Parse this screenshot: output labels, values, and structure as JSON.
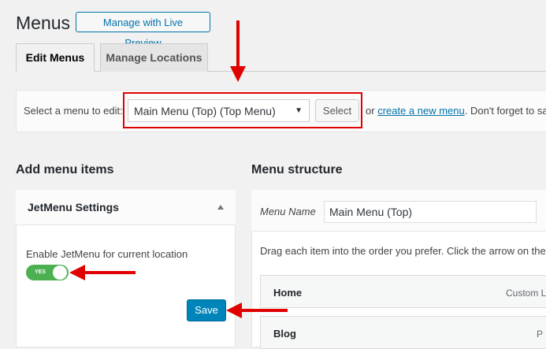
{
  "header": {
    "title": "Menus",
    "live_preview_button": "Manage with Live Preview"
  },
  "tabs": [
    {
      "label": "Edit Menus",
      "active": true
    },
    {
      "label": "Manage Locations",
      "active": false
    }
  ],
  "select_bar": {
    "label": "Select a menu to edit:",
    "selected_menu": "Main Menu (Top) (Top Menu)",
    "select_button": "Select",
    "or_text": "or",
    "create_link": "create a new menu",
    "after_text": ". Don't forget to sa"
  },
  "left": {
    "heading": "Add menu items",
    "panel_title": "JetMenu Settings",
    "enable_label": "Enable JetMenu for current location",
    "toggle_text": "YES",
    "toggle_on": true,
    "save_button": "Save"
  },
  "right": {
    "heading": "Menu structure",
    "menu_name_label": "Menu Name",
    "menu_name_value": "Main Menu (Top)",
    "instructions": "Drag each item into the order you prefer. Click the arrow on the",
    "items": [
      {
        "title": "Home",
        "type": "Custom Li"
      },
      {
        "title": "Blog",
        "type": "P"
      }
    ]
  },
  "colors": {
    "annotation_red": "#e00000",
    "toggle_green": "#4caf50",
    "primary_blue": "#0085ba",
    "link_blue": "#0073aa"
  }
}
